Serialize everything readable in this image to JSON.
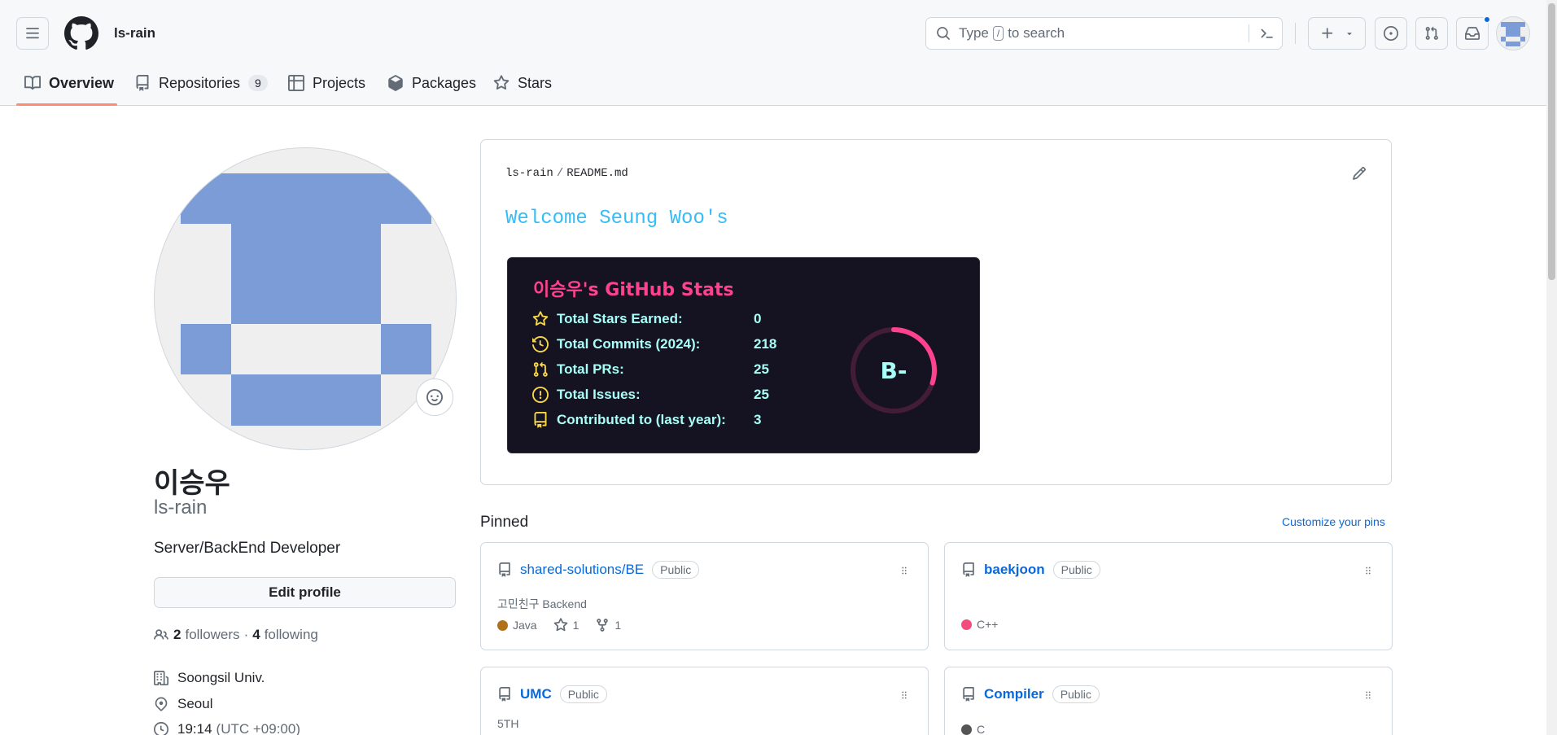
{
  "header": {
    "username": "ls-rain",
    "search_prompt_before": "Type",
    "search_prompt_key": "/",
    "search_prompt_after": "to search",
    "has_notification": true
  },
  "tabs": [
    {
      "label": "Overview",
      "active": true
    },
    {
      "label": "Repositories",
      "count": "9"
    },
    {
      "label": "Projects"
    },
    {
      "label": "Packages"
    },
    {
      "label": "Stars"
    }
  ],
  "profile": {
    "name": "이승우",
    "login": "ls-rain",
    "bio": "Server/BackEnd Developer",
    "edit_label": "Edit profile",
    "followers_count": "2",
    "followers_label": "followers",
    "separator": "·",
    "following_count": "4",
    "following_label": "following",
    "organization": "Soongsil Univ.",
    "location": "Seoul",
    "local_time": "19:14",
    "timezone": "(UTC +09:00)"
  },
  "readme": {
    "owner": "ls-rain",
    "separator": "/",
    "file": "README.md",
    "welcome": "Welcome Seung Woo's",
    "stats_card": {
      "title": "이승우's GitHub Stats",
      "rows": [
        {
          "icon": "star-icon",
          "label": "Total Stars Earned:",
          "value": "0"
        },
        {
          "icon": "history-icon",
          "label": "Total Commits (2024):",
          "value": "218"
        },
        {
          "icon": "pull-request-icon",
          "label": "Total PRs:",
          "value": "25"
        },
        {
          "icon": "issue-icon",
          "label": "Total Issues:",
          "value": "25"
        },
        {
          "icon": "repo-icon",
          "label": "Contributed to (last year):",
          "value": "3"
        }
      ],
      "rank": "B-",
      "rank_progress": 0.3,
      "colors": {
        "background": "#151321",
        "title": "#fe428e",
        "text": "#a9fef7",
        "icon": "#f8d847",
        "ring": "#fe428e"
      }
    }
  },
  "pinned": {
    "title": "Pinned",
    "customize_label": "Customize your pins",
    "repos": [
      {
        "name": "shared-solutions/BE",
        "visibility": "Public",
        "description": "고민친구 Backend",
        "language": "Java",
        "lang_color": "#b07219",
        "stars": "1",
        "forks": "1"
      },
      {
        "name": "baekjoon",
        "visibility": "Public",
        "description": "",
        "language": "C++",
        "lang_color": "#f34b7d"
      },
      {
        "name": "UMC",
        "visibility": "Public",
        "description": "5TH"
      },
      {
        "name": "Compiler",
        "visibility": "Public",
        "description": "",
        "language": "C",
        "lang_color": "#555555"
      }
    ]
  }
}
